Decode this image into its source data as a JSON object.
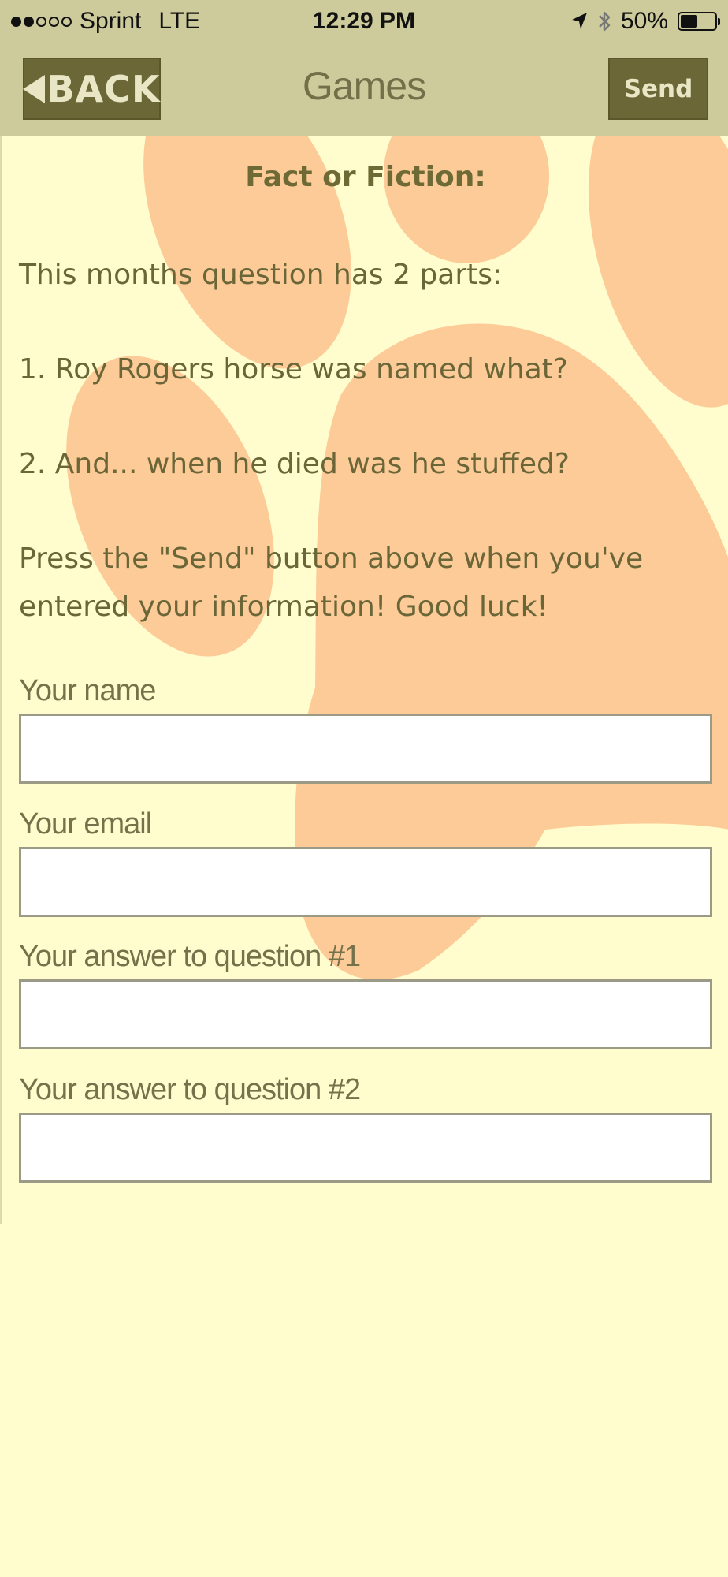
{
  "status_bar": {
    "carrier": "Sprint",
    "network": "LTE",
    "time": "12:29 PM",
    "battery_percent": "50%",
    "battery_level": 0.5,
    "signal_bars_filled": 2,
    "signal_bars_total": 5
  },
  "nav": {
    "back_label": "BACK",
    "title": "Games",
    "send_label": "Send"
  },
  "content": {
    "title": "Fact or Fiction:",
    "intro": "This months question has 2 parts:",
    "question_1": "1. Roy Rogers horse was named what?",
    "question_2": "2. And... when he died was he stuffed?",
    "instructions": "Press the \"Send\" button above when you've entered your information!  Good luck!"
  },
  "form": {
    "name_label": "Your name",
    "name_value": "",
    "email_label": "Your email",
    "email_value": "",
    "answer1_label": "Your answer to question #1",
    "answer1_value": "",
    "answer2_label": "Your answer to question #2",
    "answer2_value": ""
  },
  "colors": {
    "header_bg": "#CDCB9C",
    "button_bg": "#6B6737",
    "page_bg": "#FFFDCD",
    "paw_print": "#FDCB97",
    "text": "#6A6638"
  },
  "icons": {
    "back": "back-arrow-icon",
    "location": "location-arrow-icon",
    "bluetooth": "bluetooth-icon",
    "battery": "battery-icon",
    "background": "paw-print-icon"
  }
}
